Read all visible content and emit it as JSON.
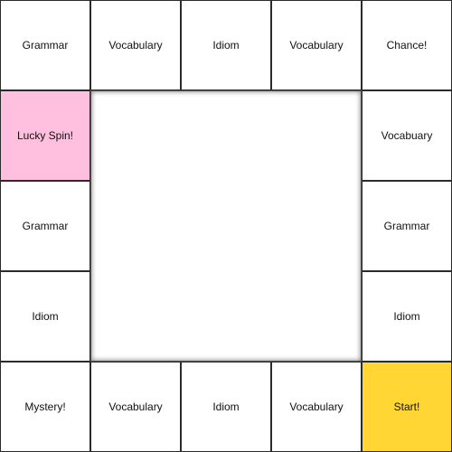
{
  "colors": {
    "lucky": "#ffc0df",
    "start": "#ffd633",
    "default": "#ffffff"
  },
  "board": {
    "top": [
      {
        "label": "Grammar",
        "color": "default"
      },
      {
        "label": "Vocabulary",
        "color": "default"
      },
      {
        "label": "Idiom",
        "color": "default"
      },
      {
        "label": "Vocabulary",
        "color": "default"
      },
      {
        "label": "Chance!",
        "color": "default"
      }
    ],
    "left": [
      {
        "label": "Lucky Spin!",
        "color": "lucky"
      },
      {
        "label": "Grammar",
        "color": "default"
      },
      {
        "label": "Idiom",
        "color": "default"
      }
    ],
    "right": [
      {
        "label": "Vocabuary",
        "color": "default"
      },
      {
        "label": "Grammar",
        "color": "default"
      },
      {
        "label": "Idiom",
        "color": "default"
      }
    ],
    "bottom": [
      {
        "label": "Mystery!",
        "color": "default"
      },
      {
        "label": "Vocabulary",
        "color": "default"
      },
      {
        "label": "Idiom",
        "color": "default"
      },
      {
        "label": "Vocabulary",
        "color": "default"
      },
      {
        "label": "Start!",
        "color": "start"
      }
    ]
  }
}
